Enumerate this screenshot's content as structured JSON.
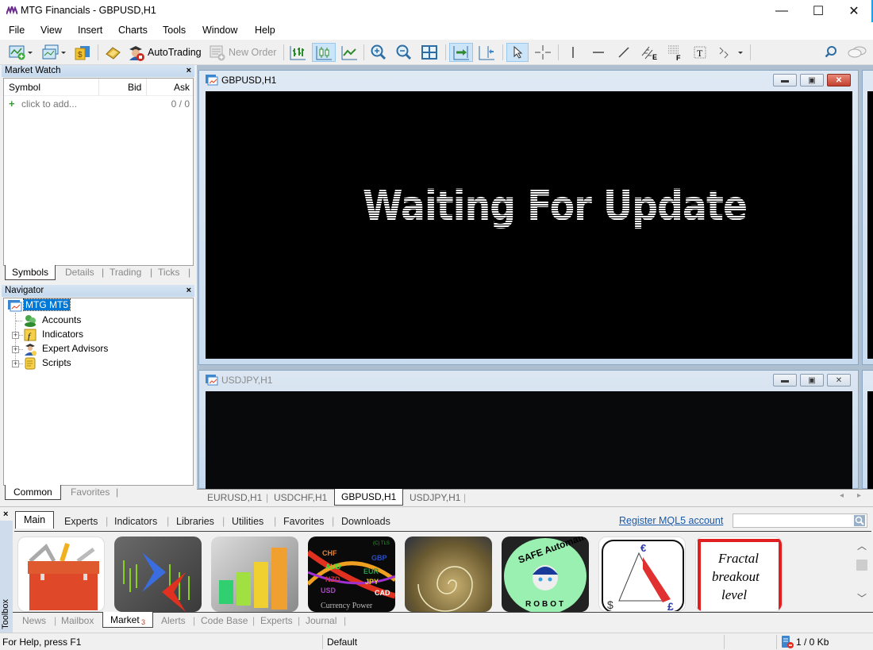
{
  "window": {
    "title": "MTG Financials - GBPUSD,H1",
    "controls": {
      "minimize": "—",
      "maximize": "☐",
      "close": "✕"
    }
  },
  "menu": [
    "File",
    "View",
    "Insert",
    "Charts",
    "Tools",
    "Window",
    "Help"
  ],
  "toolbar": {
    "autotrading_label": "AutoTrading",
    "new_order_label": "New Order",
    "icons": [
      "new-chart-icon",
      "profiles-icon",
      "strategy-tester-icon",
      "metaeditor-icon",
      "autotrading-icon",
      "new-order-icon",
      "bar-chart-icon",
      "candlestick-icon",
      "line-chart-icon",
      "zoom-in-icon",
      "zoom-out-icon",
      "tile-windows-icon",
      "autoscroll-icon",
      "chart-shift-icon",
      "cursor-icon",
      "crosshair-icon",
      "vertical-line-icon",
      "horizontal-line-icon",
      "trendline-icon",
      "equidistant-channel-icon",
      "fibonacci-icon",
      "text-icon",
      "arrows-icon",
      "search-icon",
      "chat-icon"
    ]
  },
  "market_watch": {
    "title": "Market Watch",
    "close": "×",
    "columns": [
      "Symbol",
      "Bid",
      "Ask"
    ],
    "add_row": {
      "icon": "+",
      "label": "click to add...",
      "count": "0 / 0"
    },
    "tabs": [
      "Symbols",
      "Details",
      "Trading",
      "Ticks"
    ],
    "active_tab": "Symbols"
  },
  "navigator": {
    "title": "Navigator",
    "close": "×",
    "root": "MTG MT5",
    "items": [
      {
        "label": "Accounts",
        "expandable": false
      },
      {
        "label": "Indicators",
        "expandable": true
      },
      {
        "label": "Expert Advisors",
        "expandable": true
      },
      {
        "label": "Scripts",
        "expandable": true
      }
    ],
    "tabs": [
      "Common",
      "Favorites"
    ],
    "active_tab": "Common"
  },
  "charts": [
    {
      "title": "GBPUSD,H1",
      "message": "Waiting For Update",
      "active": true
    },
    {
      "title": "USDJPY,H1",
      "active": false
    }
  ],
  "chart_tabs": [
    "EURUSD,H1",
    "USDCHF,H1",
    "GBPUSD,H1",
    "USDJPY,H1"
  ],
  "chart_tabs_active": "GBPUSD,H1",
  "toolbox": {
    "side_label": "Toolbox",
    "close": "×",
    "market_tabs": [
      "Main",
      "Experts",
      "Indicators",
      "Libraries",
      "Utilities",
      "Favorites",
      "Downloads"
    ],
    "market_active": "Main",
    "register_link": "Register MQL5 account",
    "search_placeholder": "",
    "products": [
      {
        "name": "toolbox-product"
      },
      {
        "name": "arrows-product"
      },
      {
        "name": "bar-growth-product"
      },
      {
        "name": "currency-power-product",
        "text": "Currency Power",
        "labels": [
          "CHF",
          "AUD",
          "NZD",
          "USD",
          "GBP",
          "EUR",
          "JPY",
          "CAD"
        ],
        "copyright": "(C) TLS"
      },
      {
        "name": "nautilus-product"
      },
      {
        "name": "safe-automatic-robot-product",
        "text_top": "SAFE Automatic",
        "text_bottom": "ROBOT"
      },
      {
        "name": "triangle-arbitrage-product",
        "symbols": [
          "€",
          "$",
          "£"
        ]
      },
      {
        "name": "fractal-breakout-product",
        "lines": [
          "Fractal",
          "breakout",
          "level"
        ]
      }
    ],
    "bottom_tabs": [
      "News",
      "Mailbox",
      "Market",
      "Alerts",
      "Code Base",
      "Experts",
      "Journal"
    ],
    "bottom_active": "Market",
    "market_badge": "3"
  },
  "status": {
    "help": "For Help, press F1",
    "profile": "Default",
    "traffic": "1 / 0 Kb"
  },
  "colors": {
    "accent": "#1ba1e2",
    "selected": "#0078d7",
    "link": "#1a5aa8",
    "badge": "#d03020"
  }
}
